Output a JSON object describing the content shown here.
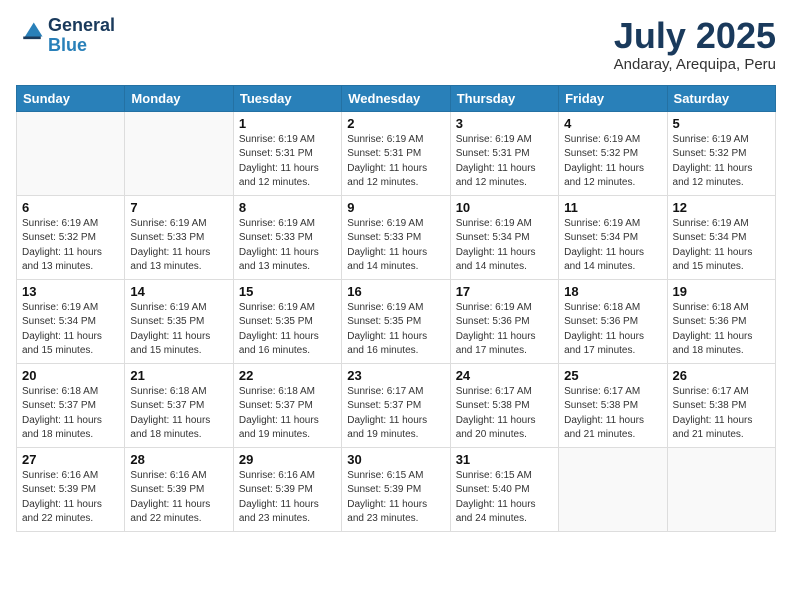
{
  "header": {
    "logo_line1": "General",
    "logo_line2": "Blue",
    "month": "July 2025",
    "location": "Andaray, Arequipa, Peru"
  },
  "weekdays": [
    "Sunday",
    "Monday",
    "Tuesday",
    "Wednesday",
    "Thursday",
    "Friday",
    "Saturday"
  ],
  "weeks": [
    [
      {
        "day": "",
        "info": ""
      },
      {
        "day": "",
        "info": ""
      },
      {
        "day": "1",
        "info": "Sunrise: 6:19 AM\nSunset: 5:31 PM\nDaylight: 11 hours and 12 minutes."
      },
      {
        "day": "2",
        "info": "Sunrise: 6:19 AM\nSunset: 5:31 PM\nDaylight: 11 hours and 12 minutes."
      },
      {
        "day": "3",
        "info": "Sunrise: 6:19 AM\nSunset: 5:31 PM\nDaylight: 11 hours and 12 minutes."
      },
      {
        "day": "4",
        "info": "Sunrise: 6:19 AM\nSunset: 5:32 PM\nDaylight: 11 hours and 12 minutes."
      },
      {
        "day": "5",
        "info": "Sunrise: 6:19 AM\nSunset: 5:32 PM\nDaylight: 11 hours and 12 minutes."
      }
    ],
    [
      {
        "day": "6",
        "info": "Sunrise: 6:19 AM\nSunset: 5:32 PM\nDaylight: 11 hours and 13 minutes."
      },
      {
        "day": "7",
        "info": "Sunrise: 6:19 AM\nSunset: 5:33 PM\nDaylight: 11 hours and 13 minutes."
      },
      {
        "day": "8",
        "info": "Sunrise: 6:19 AM\nSunset: 5:33 PM\nDaylight: 11 hours and 13 minutes."
      },
      {
        "day": "9",
        "info": "Sunrise: 6:19 AM\nSunset: 5:33 PM\nDaylight: 11 hours and 14 minutes."
      },
      {
        "day": "10",
        "info": "Sunrise: 6:19 AM\nSunset: 5:34 PM\nDaylight: 11 hours and 14 minutes."
      },
      {
        "day": "11",
        "info": "Sunrise: 6:19 AM\nSunset: 5:34 PM\nDaylight: 11 hours and 14 minutes."
      },
      {
        "day": "12",
        "info": "Sunrise: 6:19 AM\nSunset: 5:34 PM\nDaylight: 11 hours and 15 minutes."
      }
    ],
    [
      {
        "day": "13",
        "info": "Sunrise: 6:19 AM\nSunset: 5:34 PM\nDaylight: 11 hours and 15 minutes."
      },
      {
        "day": "14",
        "info": "Sunrise: 6:19 AM\nSunset: 5:35 PM\nDaylight: 11 hours and 15 minutes."
      },
      {
        "day": "15",
        "info": "Sunrise: 6:19 AM\nSunset: 5:35 PM\nDaylight: 11 hours and 16 minutes."
      },
      {
        "day": "16",
        "info": "Sunrise: 6:19 AM\nSunset: 5:35 PM\nDaylight: 11 hours and 16 minutes."
      },
      {
        "day": "17",
        "info": "Sunrise: 6:19 AM\nSunset: 5:36 PM\nDaylight: 11 hours and 17 minutes."
      },
      {
        "day": "18",
        "info": "Sunrise: 6:18 AM\nSunset: 5:36 PM\nDaylight: 11 hours and 17 minutes."
      },
      {
        "day": "19",
        "info": "Sunrise: 6:18 AM\nSunset: 5:36 PM\nDaylight: 11 hours and 18 minutes."
      }
    ],
    [
      {
        "day": "20",
        "info": "Sunrise: 6:18 AM\nSunset: 5:37 PM\nDaylight: 11 hours and 18 minutes."
      },
      {
        "day": "21",
        "info": "Sunrise: 6:18 AM\nSunset: 5:37 PM\nDaylight: 11 hours and 18 minutes."
      },
      {
        "day": "22",
        "info": "Sunrise: 6:18 AM\nSunset: 5:37 PM\nDaylight: 11 hours and 19 minutes."
      },
      {
        "day": "23",
        "info": "Sunrise: 6:17 AM\nSunset: 5:37 PM\nDaylight: 11 hours and 19 minutes."
      },
      {
        "day": "24",
        "info": "Sunrise: 6:17 AM\nSunset: 5:38 PM\nDaylight: 11 hours and 20 minutes."
      },
      {
        "day": "25",
        "info": "Sunrise: 6:17 AM\nSunset: 5:38 PM\nDaylight: 11 hours and 21 minutes."
      },
      {
        "day": "26",
        "info": "Sunrise: 6:17 AM\nSunset: 5:38 PM\nDaylight: 11 hours and 21 minutes."
      }
    ],
    [
      {
        "day": "27",
        "info": "Sunrise: 6:16 AM\nSunset: 5:39 PM\nDaylight: 11 hours and 22 minutes."
      },
      {
        "day": "28",
        "info": "Sunrise: 6:16 AM\nSunset: 5:39 PM\nDaylight: 11 hours and 22 minutes."
      },
      {
        "day": "29",
        "info": "Sunrise: 6:16 AM\nSunset: 5:39 PM\nDaylight: 11 hours and 23 minutes."
      },
      {
        "day": "30",
        "info": "Sunrise: 6:15 AM\nSunset: 5:39 PM\nDaylight: 11 hours and 23 minutes."
      },
      {
        "day": "31",
        "info": "Sunrise: 6:15 AM\nSunset: 5:40 PM\nDaylight: 11 hours and 24 minutes."
      },
      {
        "day": "",
        "info": ""
      },
      {
        "day": "",
        "info": ""
      }
    ]
  ]
}
